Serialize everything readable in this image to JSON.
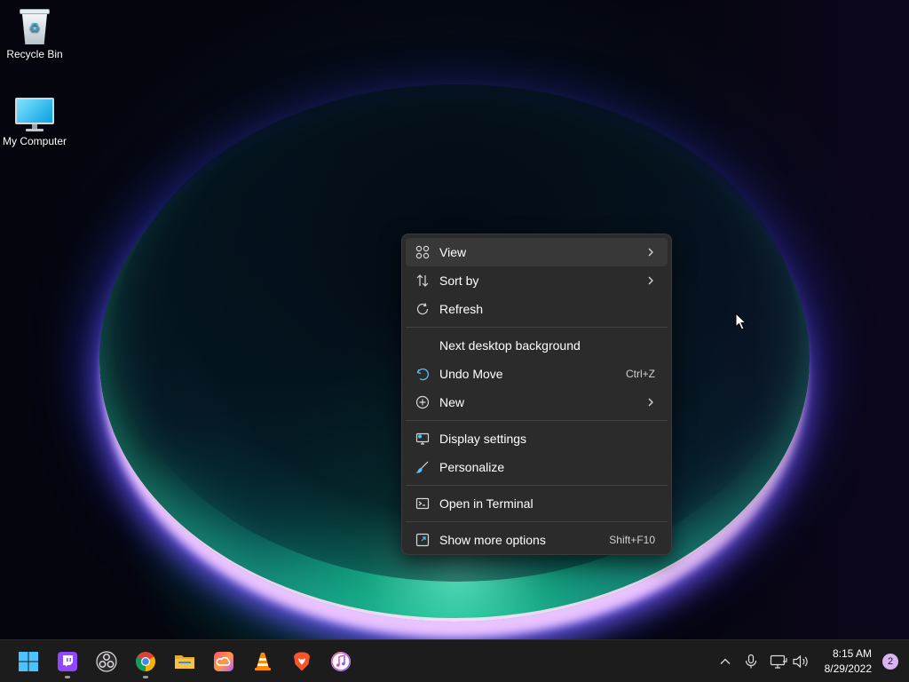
{
  "desktop": {
    "icons": [
      {
        "label": "Recycle Bin",
        "icon": "recycle-bin-icon"
      },
      {
        "label": "My Computer",
        "icon": "computer-icon"
      }
    ]
  },
  "context_menu": {
    "items": [
      {
        "label": "View",
        "icon": "grid-icon",
        "submenu": true
      },
      {
        "label": "Sort by",
        "icon": "sort-icon",
        "submenu": true
      },
      {
        "label": "Refresh",
        "icon": "refresh-icon"
      },
      {
        "label": "Next desktop background"
      },
      {
        "label": "Undo Move",
        "icon": "undo-icon",
        "shortcut": "Ctrl+Z"
      },
      {
        "label": "New",
        "icon": "plus-circle-icon",
        "submenu": true
      },
      {
        "label": "Display settings",
        "icon": "display-icon"
      },
      {
        "label": "Personalize",
        "icon": "brush-icon"
      },
      {
        "label": "Open in Terminal",
        "icon": "terminal-icon"
      },
      {
        "label": "Show more options",
        "icon": "expand-icon",
        "shortcut": "Shift+F10"
      }
    ]
  },
  "taskbar": {
    "apps": [
      {
        "name": "start",
        "icon": "windows-logo-icon"
      },
      {
        "name": "twitch",
        "icon": "twitch-icon",
        "color": "#9146ff",
        "running": true
      },
      {
        "name": "obs",
        "icon": "obs-icon"
      },
      {
        "name": "chrome",
        "icon": "chrome-icon",
        "running": true
      },
      {
        "name": "file-explorer",
        "icon": "folder-icon",
        "color": "#f5c542"
      },
      {
        "name": "creative-cloud",
        "icon": "creative-cloud-icon"
      },
      {
        "name": "vlc",
        "icon": "vlc-icon",
        "color": "#ff8800"
      },
      {
        "name": "brave",
        "icon": "brave-icon",
        "color": "#fb542b"
      },
      {
        "name": "itunes",
        "icon": "itunes-icon"
      }
    ],
    "tray": {
      "icons": [
        "chevron-up-icon",
        "microphone-icon",
        "network-icon",
        "volume-icon"
      ],
      "time": "8:15 AM",
      "date": "8/29/2022",
      "notifications": "2"
    }
  },
  "colors": {
    "menu_bg": "#2b2b2b",
    "menu_hover": "#383838",
    "taskbar_bg": "#1c1c1c",
    "accent": "#4cc2ff"
  }
}
